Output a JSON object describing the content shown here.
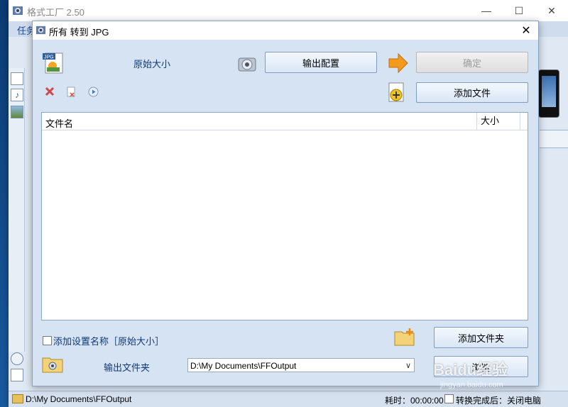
{
  "main_window": {
    "title": "格式工厂 2.50",
    "menu_label": "任务",
    "minimize": "—",
    "maximize": "☐",
    "close": "✕"
  },
  "statusbar": {
    "output_path": "D:\\My Documents\\FFOutput",
    "elapsed": "耗时：00:00:00",
    "after_done": "转换完成后：关闭电脑"
  },
  "dialog": {
    "title": "所有 转到 JPG",
    "close": "✕",
    "original_size": "原始大小",
    "output_settings_button": "输出配置",
    "ok_button": "确定",
    "add_file_button": "添加文件",
    "file_list": {
      "columns": [
        "文件名",
        "大小"
      ],
      "rows": []
    },
    "checkbox_label": "添加设置名称［原始大小］",
    "add_folder_button": "添加文件夹",
    "output_folder_label": "输出文件夹",
    "output_path": "D:\\My Documents\\FFOutput",
    "browse_button": "浏览"
  },
  "watermark": {
    "text": "Baidu经验",
    "url": "jingyan.baidu.com"
  },
  "colors": {
    "dialog_bg": "#d5e3f3",
    "button_border": "#7f9cc4",
    "label_blue": "#103a78"
  }
}
